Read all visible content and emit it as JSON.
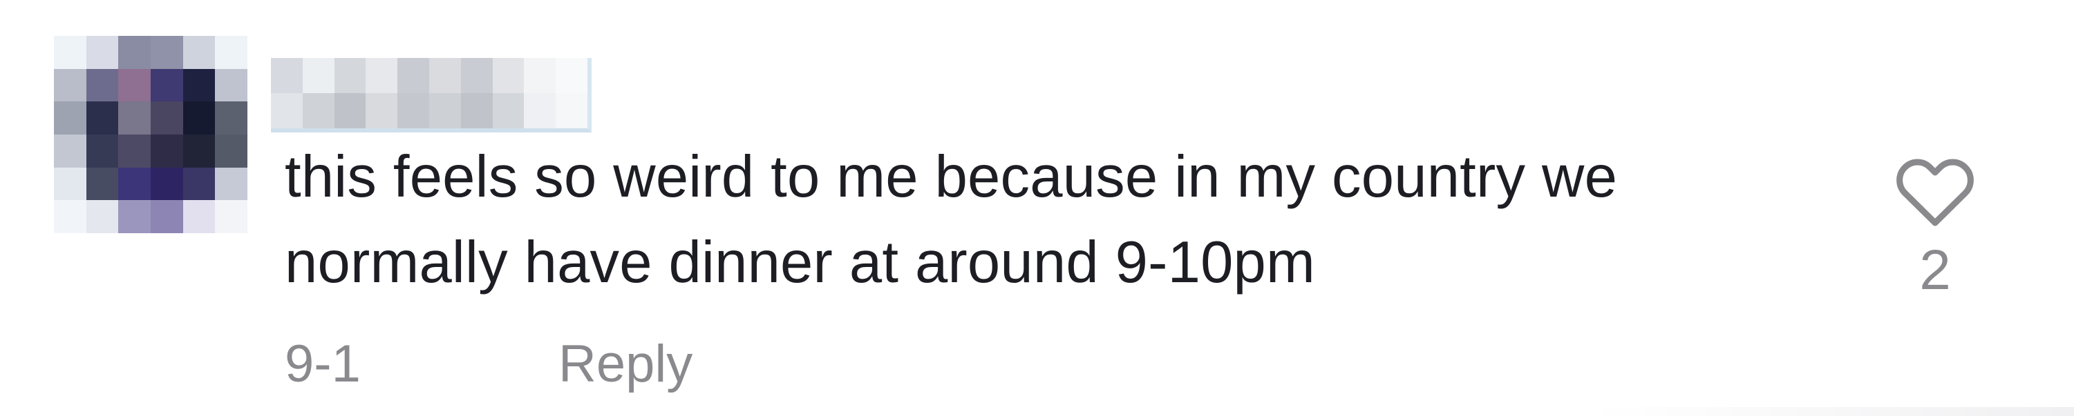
{
  "comment": {
    "text": "this feels so weird to me because in my country we normally have dinner at around 9-10pm",
    "date": "9-1",
    "reply_label": "Reply",
    "like_count": "2",
    "like_icon": "heart-outline-icon"
  },
  "colors": {
    "text": "#1d1d24",
    "secondary": "#8a8a8e",
    "icon": "#8a8a8e",
    "background": "#ffffff"
  }
}
